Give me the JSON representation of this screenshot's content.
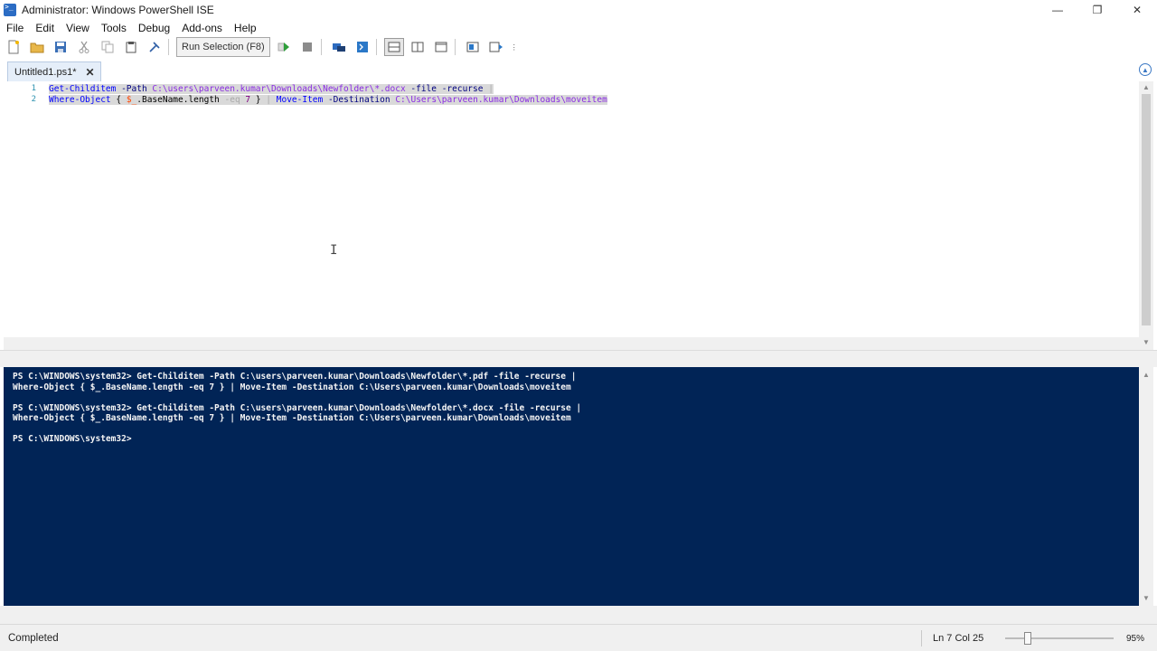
{
  "window": {
    "title": "Administrator: Windows PowerShell ISE",
    "controls": {
      "minimize": "—",
      "restore": "❐",
      "close": "✕"
    }
  },
  "menu": [
    "File",
    "Edit",
    "View",
    "Tools",
    "Debug",
    "Add-ons",
    "Help"
  ],
  "toolbar": {
    "run_selection_label": "Run Selection (F8)",
    "icons": [
      "new-file-icon",
      "open-folder-icon",
      "save-icon",
      "cut-icon",
      "copy-icon",
      "paste-icon",
      "clear-icon",
      "run-script-icon",
      "stop-icon",
      "remote-tab-icon",
      "powershell-icon",
      "layout-top-icon",
      "layout-right-icon",
      "layout-max-icon",
      "show-script-pane-icon",
      "commands-icon"
    ]
  },
  "tab": {
    "label": "Untitled1.ps1*",
    "close": "✕"
  },
  "editor": {
    "line_numbers": [
      "1",
      "2"
    ],
    "line1": {
      "cmd": "Get-Childitem",
      "param": " -Path ",
      "path": "C:\\users\\parveen.kumar\\Downloads\\Newfolder\\*.docx",
      "rest": " -file -recurse ",
      "pipe": "|"
    },
    "line2": {
      "cmd": "Where-Object",
      "brace_open": " { ",
      "var": "$_",
      "prop": ".BaseName.length ",
      "op": "-eq ",
      "num": "7",
      "brace_close": " } ",
      "pipe": "| ",
      "cmd2": "Move-Item",
      "param": " -Destination ",
      "path": "C:\\Users\\parveen.kumar\\Downloads\\moveitem"
    }
  },
  "console": {
    "lines": [
      "PS C:\\WINDOWS\\system32> Get-Childitem -Path C:\\users\\parveen.kumar\\Downloads\\Newfolder\\*.pdf -file -recurse |",
      "Where-Object { $_.BaseName.length -eq 7 } | Move-Item -Destination C:\\Users\\parveen.kumar\\Downloads\\moveitem",
      "",
      "PS C:\\WINDOWS\\system32> Get-Childitem -Path C:\\users\\parveen.kumar\\Downloads\\Newfolder\\*.docx -file -recurse |",
      "Where-Object { $_.BaseName.length -eq 7 } | Move-Item -Destination C:\\Users\\parveen.kumar\\Downloads\\moveitem",
      "",
      "PS C:\\WINDOWS\\system32>"
    ]
  },
  "status": {
    "text": "Completed",
    "position": "Ln 7  Col 25",
    "zoom": "95%",
    "zoom_level": 0.95
  }
}
